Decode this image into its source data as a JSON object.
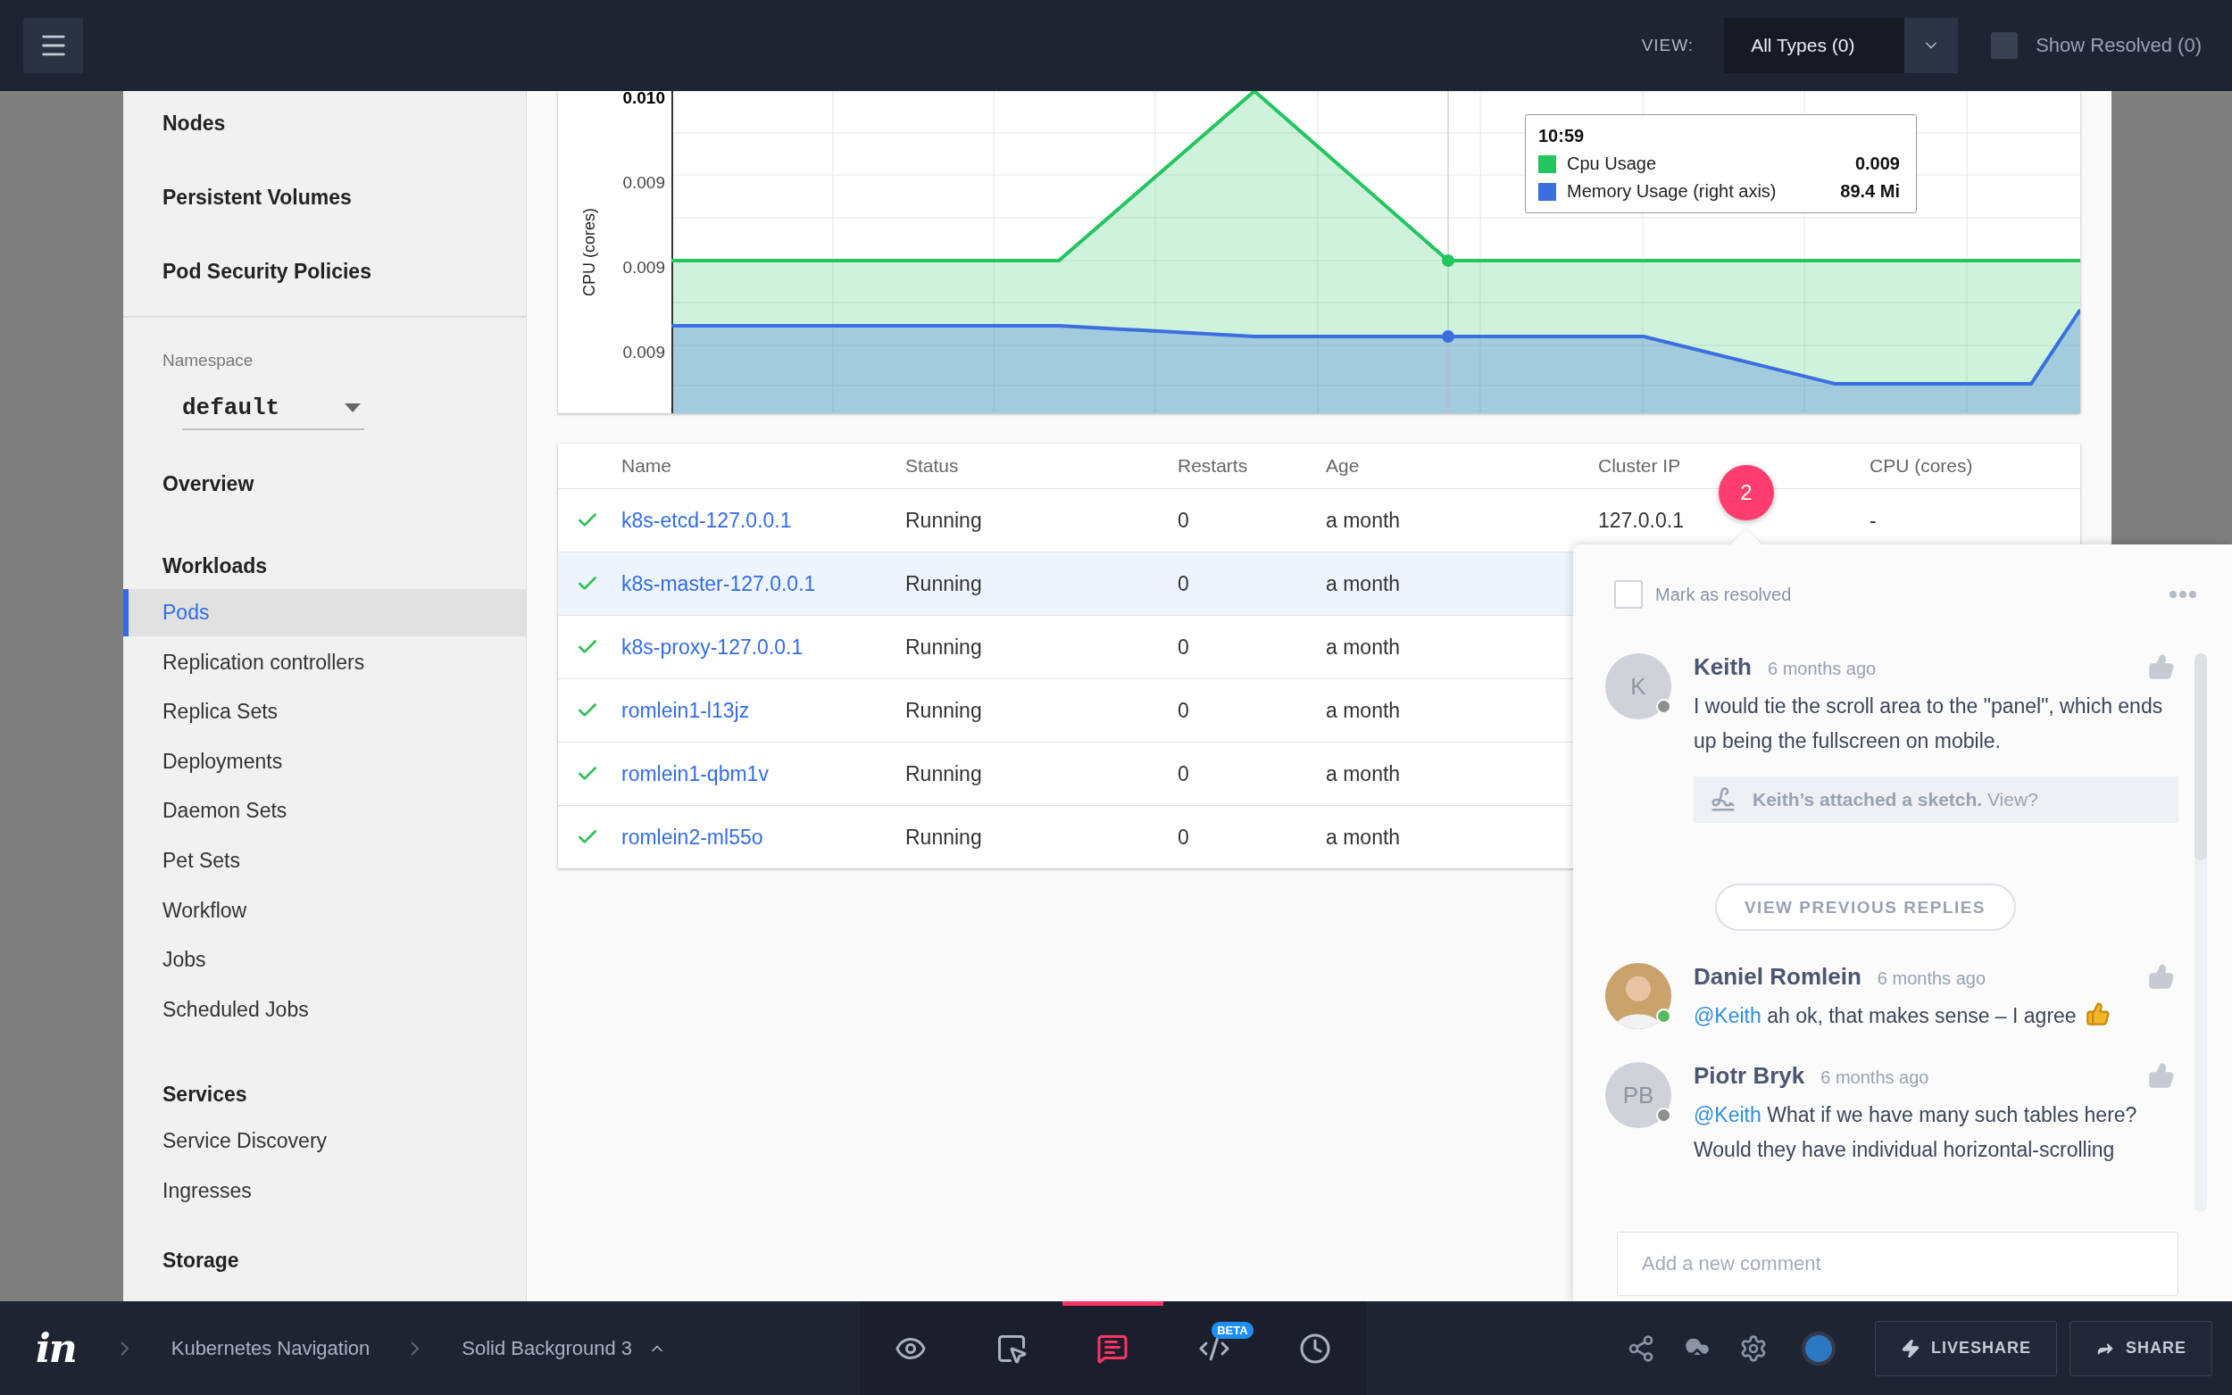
{
  "topbar": {
    "view_label": "VIEW:",
    "view_select": "All Types (0)",
    "show_resolved": {
      "label": "Show Resolved (0)",
      "checked": false
    }
  },
  "sidebar": {
    "top_items": [
      "Nodes",
      "Persistent Volumes",
      "Pod Security Policies"
    ],
    "namespace": {
      "label": "Namespace",
      "value": "default"
    },
    "sections": [
      {
        "title": "Overview"
      },
      {
        "title": "Workloads",
        "items": [
          {
            "label": "Pods",
            "selected": true
          },
          {
            "label": "Replication controllers",
            "selected": false
          },
          {
            "label": "Replica Sets",
            "selected": false
          },
          {
            "label": "Deployments",
            "selected": false
          },
          {
            "label": "Daemon Sets",
            "selected": false
          },
          {
            "label": "Pet Sets",
            "selected": false
          },
          {
            "label": "Workflow",
            "selected": false
          },
          {
            "label": "Jobs",
            "selected": false
          },
          {
            "label": "Scheduled Jobs",
            "selected": false
          }
        ]
      },
      {
        "title": "Services",
        "items": [
          {
            "label": "Service Discovery",
            "selected": false
          },
          {
            "label": "Ingresses",
            "selected": false
          }
        ]
      },
      {
        "title": "Storage"
      }
    ]
  },
  "chart": {
    "y_axis_label": "CPU (cores)",
    "y_ticks": [
      "0.010",
      "0.009",
      "0.009",
      "0.009"
    ],
    "tooltip": {
      "time": "10:59",
      "entries": [
        {
          "name": "Cpu Usage",
          "value": "0.009",
          "color": "#22c55e"
        },
        {
          "name": "Memory Usage (right axis)",
          "value": "89.4 Mi",
          "color": "#3b6fe0"
        }
      ]
    }
  },
  "table": {
    "columns": [
      "Name",
      "Status",
      "Restarts",
      "Age",
      "Cluster IP",
      "CPU (cores)"
    ],
    "rows": [
      {
        "selected": false,
        "cells": [
          "k8s-etcd-127.0.0.1",
          "Running",
          "0",
          "a month",
          "127.0.0.1",
          "-"
        ]
      },
      {
        "selected": true,
        "cells": [
          "k8s-master-127.0.0.1",
          "Running",
          "0",
          "a month"
        ]
      },
      {
        "selected": false,
        "cells": [
          "k8s-proxy-127.0.0.1",
          "Running",
          "0",
          "a month"
        ]
      },
      {
        "selected": false,
        "cells": [
          "romlein1-l13jz",
          "Running",
          "0",
          "a month"
        ]
      },
      {
        "selected": false,
        "cells": [
          "romlein1-qbm1v",
          "Running",
          "0",
          "a month"
        ]
      },
      {
        "selected": false,
        "cells": [
          "romlein2-ml55o",
          "Running",
          "0",
          "a month"
        ]
      }
    ]
  },
  "comment_badge": "2",
  "comment_panel": {
    "mark_resolved": {
      "label": "Mark as resolved",
      "checked": false
    },
    "entries": [
      {
        "kind": "comment",
        "author": "Keith",
        "initials": "K",
        "color": "#8e8e93",
        "time": "6 months ago",
        "text": "I would tie the scroll area to the \"panel\", which ends up being the fullscreen on mobile.",
        "attachment": "**Keith’s attached a sketch.** View?"
      },
      {
        "kind": "more",
        "label": "VIEW PREVIOUS REPLIES"
      },
      {
        "kind": "comment",
        "author": "Daniel Romlein",
        "color": "#5cb85c",
        "time": "6 months ago",
        "mention": "@Keith",
        "text": "ah ok, that makes sense – I agree",
        "reaction_icon": true
      },
      {
        "kind": "comment",
        "author": "Piotr Bryk",
        "initials": "PB",
        "color": "#8e8e93",
        "time": "6 months ago",
        "mention": "@Keith",
        "text": "What if we have many such tables here? Would they have individual horizontal-scrolling"
      }
    ],
    "placeholder": "Add a new comment"
  },
  "bottombar": {
    "logo": "in",
    "breadcrumbs": [
      "Kubernetes Navigation",
      "Solid Background 3"
    ],
    "tools": [
      {
        "kind": "preview",
        "selected": false
      },
      {
        "kind": "inspect",
        "selected": false
      },
      {
        "kind": "comments",
        "selected": true
      },
      {
        "kind": "code",
        "selected": false,
        "badge": "BETA"
      },
      {
        "kind": "history",
        "selected": false
      }
    ],
    "buttons": [
      {
        "kind": "liveshare",
        "label": "LIVESHARE"
      },
      {
        "kind": "share",
        "label": "SHARE"
      }
    ]
  }
}
